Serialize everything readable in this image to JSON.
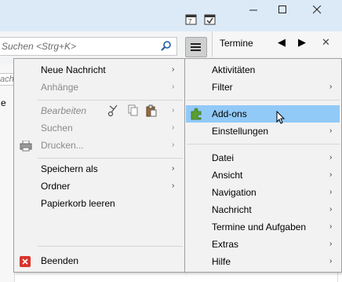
{
  "search": {
    "placeholder": "Suchen <Strg+K>"
  },
  "side_panel": {
    "title": "Termine",
    "prev_symbol": "◀",
    "next_symbol": "▶",
    "close_symbol": "✕"
  },
  "left_strip": {
    "fragment_1": "ach",
    "fragment_2": "e"
  },
  "main_menu": {
    "items": [
      {
        "label": "Neue Nachricht",
        "submenu": true,
        "disabled": false
      },
      {
        "label": "Anhänge",
        "submenu": true,
        "disabled": true
      },
      {
        "label": "Bearbeiten",
        "submenu": true,
        "disabled": true,
        "italic": true
      },
      {
        "label": "Suchen",
        "submenu": true,
        "disabled": true
      },
      {
        "label": "Drucken...",
        "submenu": true,
        "disabled": true,
        "icon": "printer-icon"
      },
      {
        "label": "Speichern als",
        "submenu": true,
        "disabled": false
      },
      {
        "label": "Ordner",
        "submenu": true,
        "disabled": false
      },
      {
        "label": "Papierkorb leeren",
        "submenu": false,
        "disabled": false
      },
      {
        "label": "Beenden",
        "submenu": false,
        "disabled": false,
        "icon": "exit-icon"
      }
    ]
  },
  "app_menu": {
    "items": [
      {
        "label": "Aktivitäten",
        "submenu": false
      },
      {
        "label": "Filter",
        "submenu": true
      },
      {
        "label": "Add-ons",
        "submenu": false,
        "highlighted": true,
        "icon": "puzzle-icon"
      },
      {
        "label": "Einstellungen",
        "submenu": true
      },
      {
        "label": "Datei",
        "submenu": true
      },
      {
        "label": "Ansicht",
        "submenu": true
      },
      {
        "label": "Navigation",
        "submenu": true
      },
      {
        "label": "Nachricht",
        "submenu": true
      },
      {
        "label": "Termine und Aufgaben",
        "submenu": true
      },
      {
        "label": "Extras",
        "submenu": true
      },
      {
        "label": "Hilfe",
        "submenu": true
      }
    ]
  },
  "colors": {
    "highlight": "#91c9f7",
    "titlebar": "#dceaf7",
    "menu_bg": "#f2f2f2"
  }
}
